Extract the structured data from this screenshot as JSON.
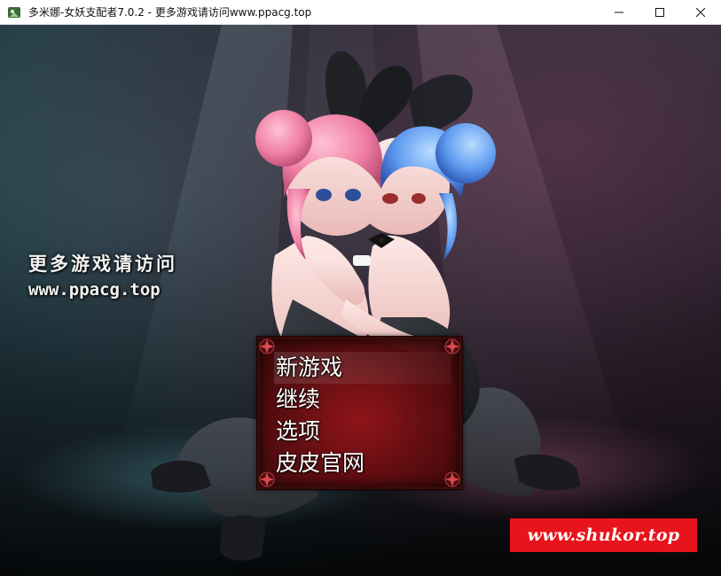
{
  "window": {
    "title": "多米娜-女妖支配者7.0.2 - 更多游戏请访问www.ppacg.top",
    "controls": [
      "minimize",
      "maximize",
      "close"
    ]
  },
  "promo": {
    "line1": "更多游戏请访问",
    "line2": "www.ppacg.top"
  },
  "menu": {
    "items": [
      {
        "label": "新游戏",
        "selected": true
      },
      {
        "label": "继续",
        "selected": false
      },
      {
        "label": "选项",
        "selected": false
      },
      {
        "label": "皮皮官网",
        "selected": false
      }
    ]
  },
  "watermark": {
    "text": "www.shukor.top",
    "color": "#e8141b"
  },
  "colors": {
    "menu_background": "#7a0d12",
    "menu_border": "#3a0b0b",
    "menu_text": "#ffffff"
  }
}
